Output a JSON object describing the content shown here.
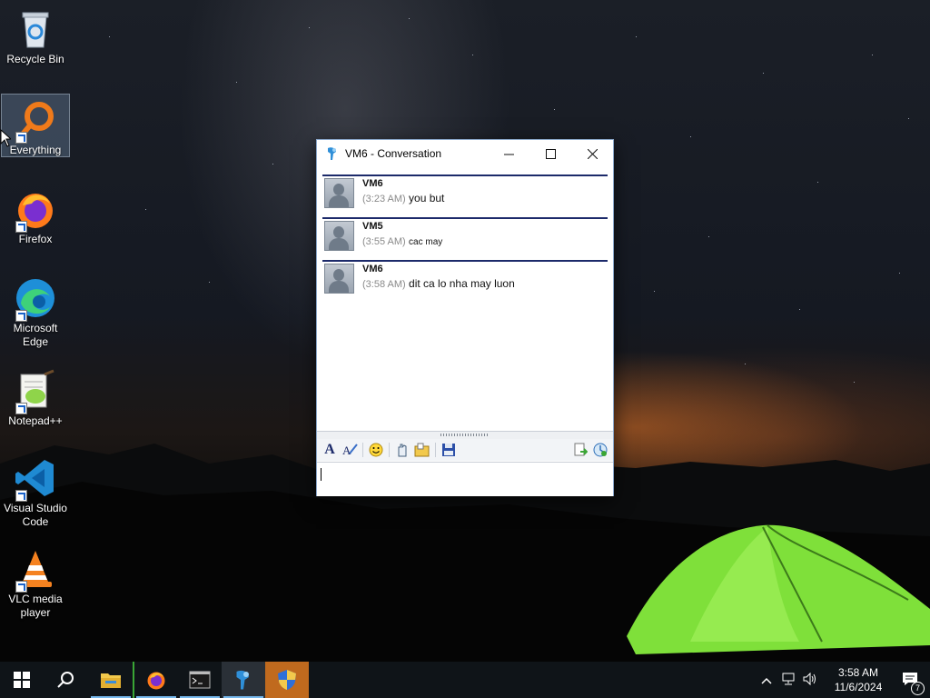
{
  "desktop": {
    "icons": [
      {
        "label": "Recycle Bin"
      },
      {
        "label": "Everything"
      },
      {
        "label": "Firefox"
      },
      {
        "label": "Microsoft Edge"
      },
      {
        "label": "Notepad++"
      },
      {
        "label": "Visual Studio Code"
      },
      {
        "label": "VLC media player"
      }
    ]
  },
  "window": {
    "title": "VM6 - Conversation",
    "messages": [
      {
        "sender": "VM6",
        "time": "(3:23 AM)",
        "text": "you but"
      },
      {
        "sender": "VM5",
        "time": "(3:55 AM)",
        "text": "cac may"
      },
      {
        "sender": "VM6",
        "time": "(3:58 AM)",
        "text": "dit ca lo nha may luon"
      }
    ],
    "input_value": ""
  },
  "taskbar": {
    "clock_time": "3:58 AM",
    "clock_date": "11/6/2024",
    "notification_count": "7"
  },
  "colors": {
    "taskbar_bg": "#0f1418",
    "message_divider": "#1c2a6a",
    "active_indicator": "#76b9ed"
  }
}
